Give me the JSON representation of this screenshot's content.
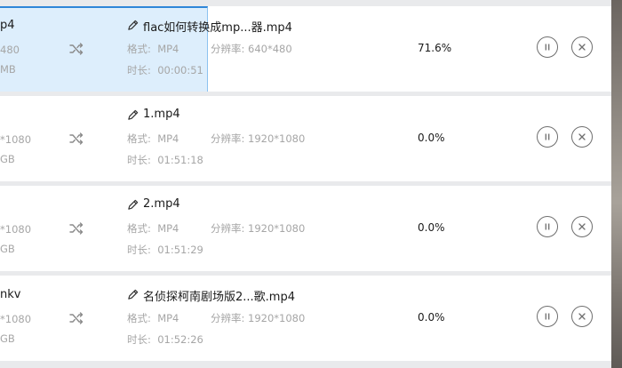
{
  "labels": {
    "format": "格式:",
    "resolution": "分辨率:",
    "duration": "时长:"
  },
  "tasks": [
    {
      "source_name": "p4",
      "source_resolution": "480",
      "source_size": "MB",
      "output_name": "flac如何转换成mp...器.mp4",
      "format": "MP4",
      "resolution": "640*480",
      "duration": "00:00:51",
      "progress_text": "71.6%",
      "progress": 0.716
    },
    {
      "source_name": "",
      "source_resolution": "*1080",
      "source_size": "GB",
      "output_name": "1.mp4",
      "format": "MP4",
      "resolution": "1920*1080",
      "duration": "01:51:18",
      "progress_text": "0.0%",
      "progress": 0
    },
    {
      "source_name": "",
      "source_resolution": "*1080",
      "source_size": "GB",
      "output_name": "2.mp4",
      "format": "MP4",
      "resolution": "1920*1080",
      "duration": "01:51:29",
      "progress_text": "0.0%",
      "progress": 0
    },
    {
      "source_name": "nkv",
      "source_resolution": "*1080",
      "source_size": "GB",
      "output_name": "名侦探柯南剧场版2...歌.mp4",
      "format": "MP4",
      "resolution": "1920*1080",
      "duration": "01:52:26",
      "progress_text": "0.0%",
      "progress": 0
    }
  ],
  "icons": {
    "convert": "shuffle-icon",
    "rename": "pencil-icon",
    "pause": "pause-icon",
    "remove": "close-icon"
  },
  "colors": {
    "progress_fill": "#ddeefc",
    "progress_accent": "#2f86d8"
  }
}
